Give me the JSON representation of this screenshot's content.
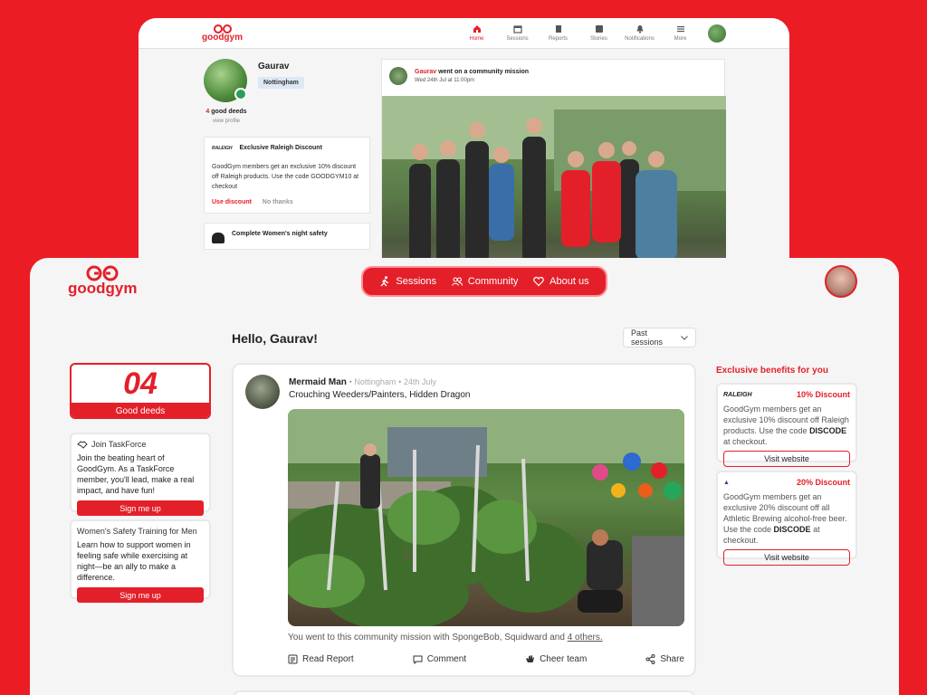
{
  "old": {
    "logo": "goodgym",
    "nav": [
      {
        "label": "Home",
        "icon": "home-icon",
        "active": true
      },
      {
        "label": "Sessions",
        "icon": "calendar-icon",
        "active": false
      },
      {
        "label": "Reports",
        "icon": "report-icon",
        "active": false
      },
      {
        "label": "Stories",
        "icon": "stories-icon",
        "active": false
      },
      {
        "label": "Notifications",
        "icon": "bell-icon",
        "active": false
      },
      {
        "label": "More",
        "icon": "menu-icon",
        "active": false
      }
    ],
    "profile": {
      "name": "Gaurav",
      "location": "Nottingham",
      "deeds_count": "4",
      "deeds_label": "good deeds",
      "view_profile": "view profile"
    },
    "discount_card": {
      "brand": "RALEIGH",
      "title": "Exclusive Raleigh Discount",
      "text": "GoodGym members get an exclusive 10% discount off Raleigh products. Use the code GOODGYM10 at checkout",
      "use": "Use discount",
      "no": "No thanks"
    },
    "safety_card": {
      "title": "Complete Women's night safety"
    },
    "feed": {
      "user": "Gaurav",
      "action": " went on a community mission",
      "date": "Wed 24th Jul at 11:00pm"
    }
  },
  "new": {
    "logo": "goodgym",
    "nav": [
      {
        "label": "Sessions",
        "icon": "runner-icon"
      },
      {
        "label": "Community",
        "icon": "people-icon"
      },
      {
        "label": "About us",
        "icon": "heart-icon"
      }
    ],
    "hello": "Hello, Gaurav!",
    "filter": "Past sessions",
    "deeds": {
      "number": "04",
      "label": "Good deeds"
    },
    "taskforce": {
      "title": "Join TaskForce",
      "text": "Join the beating heart of GoodGym. As a TaskForce member, you'll lead, make a real impact, and have fun!",
      "button": "Sign me up"
    },
    "safety": {
      "title": "Women's Safety Training for Men",
      "text": "Learn how to support women in feeling safe while exercising at night—be an ally to make a difference.",
      "button": "Sign me up"
    },
    "post": {
      "user": "Mermaid Man",
      "location": "Nottingham",
      "date": "24th July",
      "activity": "Crouching Weeders/Painters, Hidden Dragon",
      "caption": "You went to this community mission with SpongeBob, Squidward and ",
      "caption_link": "4 others.",
      "actions": [
        {
          "label": "Read Report",
          "icon": "report-icon"
        },
        {
          "label": "Comment",
          "icon": "comment-icon"
        },
        {
          "label": "Cheer team",
          "icon": "clap-icon"
        },
        {
          "label": "Share",
          "icon": "share-icon"
        }
      ]
    },
    "benefits_title": "Exclusive benefits for you",
    "benefits": [
      {
        "brand": "RALEIGH",
        "pct": "10% Discount",
        "text_a": "GoodGym members get an exclusive 10% discount off Raleigh products. Use the code ",
        "code": "DISCODE",
        "text_b": " at checkout.",
        "button": "Visit website"
      },
      {
        "brand": "▲",
        "pct": "20% Discount",
        "text_a": "GoodGym members get an exclusive 20% discount off all Athletic Brewing alcohol-free beer. Use the code ",
        "code": "DISCODE",
        "text_b": " at checkout.",
        "button": "Visit website"
      }
    ],
    "colors": {
      "brand": "#e3202a",
      "background": "#ec1c24"
    }
  }
}
